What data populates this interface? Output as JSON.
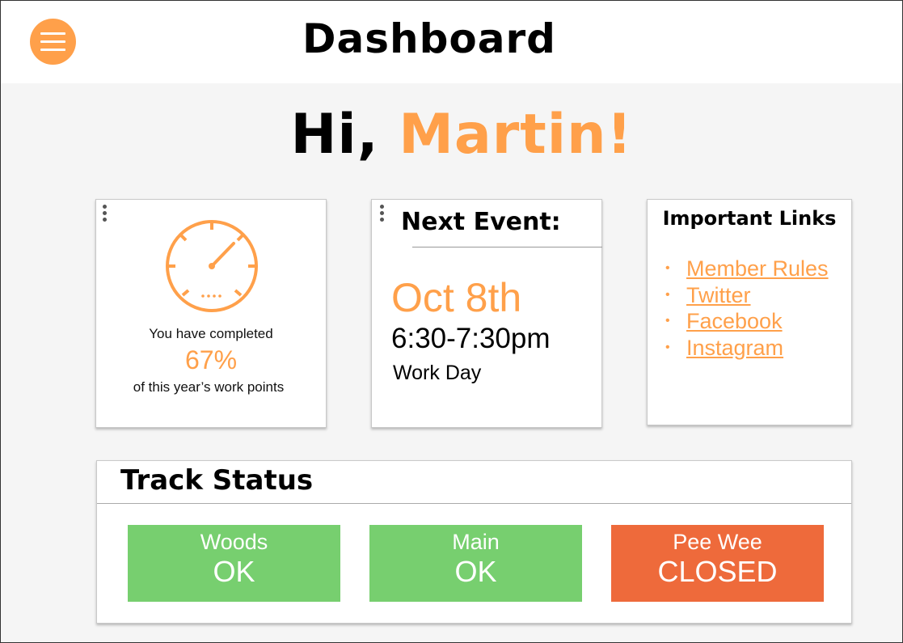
{
  "header": {
    "title": "Dashboard",
    "menu_icon": "hamburger-menu-icon"
  },
  "greeting": {
    "prefix": "Hi, ",
    "name": "Martin!"
  },
  "progress_card": {
    "icon": "speedometer-icon",
    "line1": "You have completed",
    "percent": "67%",
    "line2": "of this year’s work points"
  },
  "event_card": {
    "heading": "Next Event:",
    "date": "Oct 8th",
    "time": "6:30-7:30pm",
    "name": "Work Day"
  },
  "links_card": {
    "heading": "Important Links",
    "links": [
      {
        "label": "Member Rules"
      },
      {
        "label": "Twitter"
      },
      {
        "label": "Facebook"
      },
      {
        "label": "Instagram"
      }
    ]
  },
  "track_status": {
    "heading": "Track Status",
    "tracks": [
      {
        "name": "Woods",
        "status": "OK",
        "color": "#77cf6f"
      },
      {
        "name": "Main",
        "status": "OK",
        "color": "#77cf6f"
      },
      {
        "name": "Pee Wee",
        "status": "CLOSED",
        "color": "#ee6a3b"
      }
    ]
  },
  "colors": {
    "accent": "#ffa04a",
    "ok": "#77cf6f",
    "closed": "#ee6a3b"
  }
}
